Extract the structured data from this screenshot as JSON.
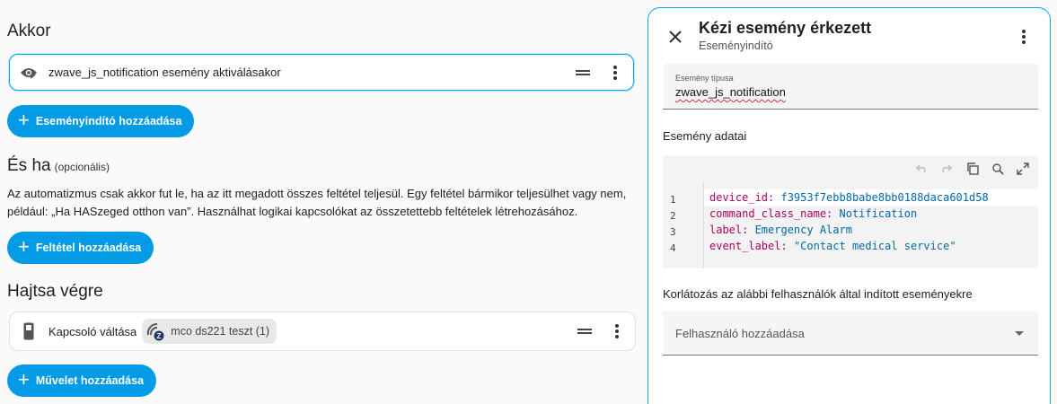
{
  "left": {
    "trigger_heading": "Akkor",
    "trigger_card": {
      "label": "zwave_js_notification esemény aktiválásakor",
      "icon": "eye-off-icon"
    },
    "add_trigger_label": "Eseményindító hozzáadása",
    "condition_heading": "És ha",
    "condition_optional": "(opcionális)",
    "condition_description": "Az automatizmus csak akkor fut le, ha az itt megadott összes feltétel teljesül. Egy feltétel bármikor teljesülhet vagy nem, például: „Ha HASzeged otthon van”. Használhat logikai kapcsolókat az összetettebb feltételek létrehozásához.",
    "add_condition_label": "Feltétel hozzáadása",
    "action_heading": "Hajtsa végre",
    "action_card": {
      "label": "Kapcsoló váltása",
      "icon": "switch-icon",
      "chip_label": "mco ds221 teszt (1)",
      "chip_icon": "zwave-icon"
    },
    "add_action_label": "Művelet hozzáadása"
  },
  "panel": {
    "title": "Kézi esemény érkezett",
    "subtitle": "Eseményindító",
    "event_type_label": "Esemény típusa",
    "event_type_value": "zwave_js_notification",
    "event_data_heading": "Esemény adatai",
    "code_lines": [
      {
        "num": "1",
        "key": "device_id",
        "value": "f3953f7ebb8babe8bb0188daca601d58"
      },
      {
        "num": "2",
        "key": "command_class_name",
        "value": "Notification"
      },
      {
        "num": "3",
        "key": "label",
        "value": "Emergency Alarm"
      },
      {
        "num": "4",
        "key": "event_label",
        "value": "\"Contact medical service\""
      }
    ],
    "restrict_heading": "Korlátozás az alábbi felhasználók által indított eseményekre",
    "add_user_placeholder": "Felhasználó hozzáadása"
  },
  "colors": {
    "accent": "#039be5",
    "selected_border": "#03a9f4"
  }
}
